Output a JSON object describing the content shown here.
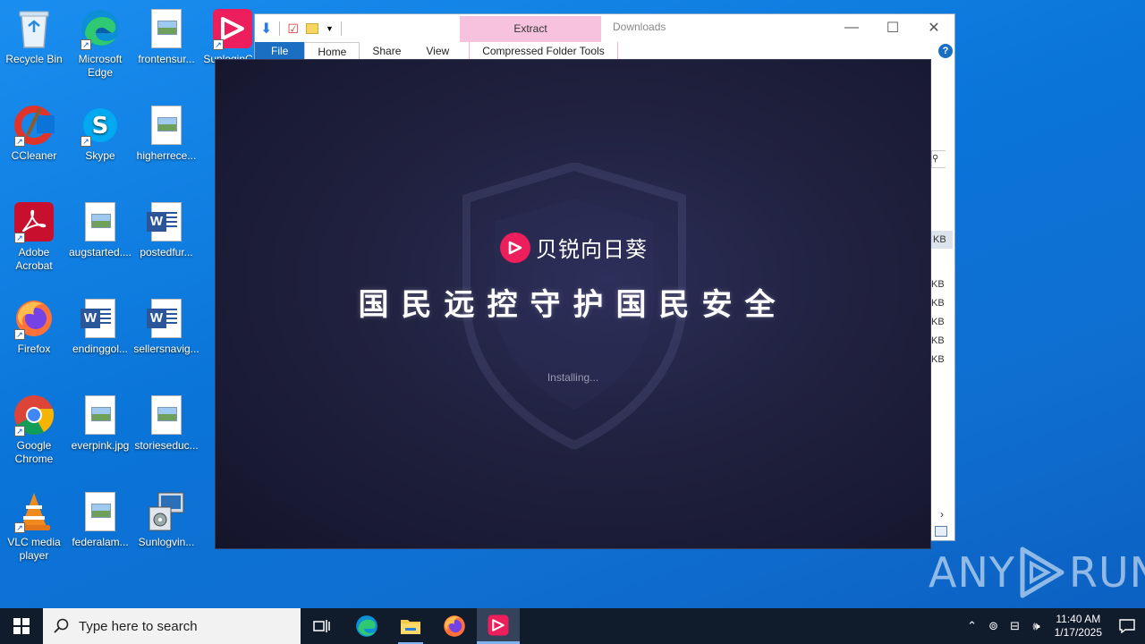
{
  "desktop": {
    "icons": [
      {
        "label": "Recycle Bin",
        "icon": "recycle-bin-icon"
      },
      {
        "label": "Microsoft Edge",
        "icon": "edge-icon"
      },
      {
        "label": "frontensur...",
        "icon": "image-file-icon"
      },
      {
        "label": "SunloginC...",
        "icon": "sunlogin-icon"
      },
      {
        "label": "CCleaner",
        "icon": "ccleaner-icon"
      },
      {
        "label": "Skype",
        "icon": "skype-icon"
      },
      {
        "label": "higherrece...",
        "icon": "image-file-icon"
      },
      {
        "label": "Adobe Acrobat",
        "icon": "acrobat-icon"
      },
      {
        "label": "augstarted....",
        "icon": "image-file-icon"
      },
      {
        "label": "postedfur...",
        "icon": "word-file-icon"
      },
      {
        "label": "Firefox",
        "icon": "firefox-icon"
      },
      {
        "label": "endinggol...",
        "icon": "word-file-icon"
      },
      {
        "label": "sellersnavig...",
        "icon": "word-file-icon"
      },
      {
        "label": "Google Chrome",
        "icon": "chrome-icon"
      },
      {
        "label": "everpink.jpg",
        "icon": "image-file-icon"
      },
      {
        "label": "storieseduc...",
        "icon": "image-file-icon"
      },
      {
        "label": "VLC media player",
        "icon": "vlc-icon"
      },
      {
        "label": "federalam...",
        "icon": "image-file-icon"
      },
      {
        "label": "Sunlogvin...",
        "icon": "installer-icon"
      }
    ]
  },
  "explorer": {
    "title": "Downloads",
    "context_tab": "Extract",
    "tabs": [
      "File",
      "Home",
      "Share",
      "View"
    ],
    "context_tab_label": "Compressed Folder Tools",
    "help": "?",
    "size_unit": "KB",
    "size_cells": [
      "KB",
      "KB",
      "KB",
      "KB",
      "KB",
      "KB"
    ]
  },
  "installer": {
    "brand": "贝锐向日葵",
    "slogan": "国民远控守护国民安全",
    "status": "Installing..."
  },
  "taskbar": {
    "search_placeholder": "Type here to search",
    "time": "11:40 AM",
    "date": "1/17/2025"
  },
  "watermark": {
    "text_left": "ANY",
    "text_right": "RUN"
  },
  "colors": {
    "desktop_blue": "#0a74d8",
    "installer_bg": "#20213f",
    "brand_red": "#ec1e5b",
    "extract_pink": "#f7c2de",
    "file_tab_blue": "#1a6fc2",
    "taskbar": "#101b2b"
  }
}
